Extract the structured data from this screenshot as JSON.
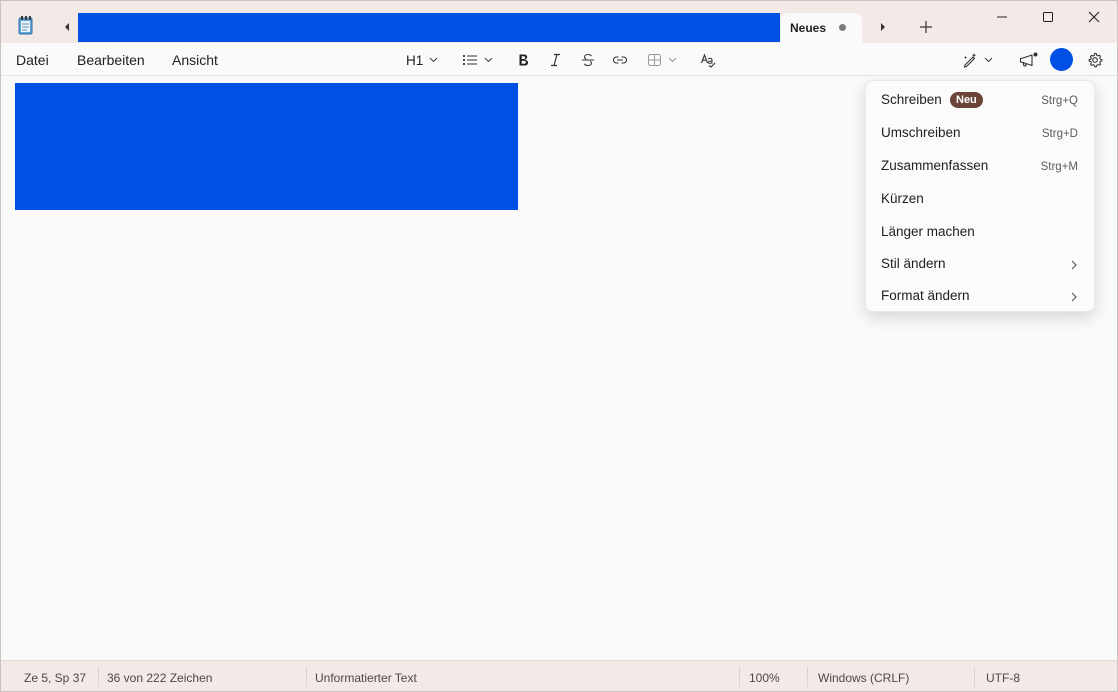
{
  "titlebar": {
    "active_tab": "Neues",
    "tab_modified": true
  },
  "menu": {
    "datei": "Datei",
    "bearbeiten": "Bearbeiten",
    "ansicht": "Ansicht"
  },
  "toolbar": {
    "heading_level": "H1",
    "icons": [
      "list-icon",
      "bold-icon",
      "italic-icon",
      "strikethrough-icon",
      "link-icon",
      "table-icon",
      "spellcheck-icon",
      "copilot-pen-icon",
      "megaphone-icon",
      "settings-icon"
    ]
  },
  "popup": {
    "items": [
      {
        "label": "Schreiben",
        "badge": "Neu",
        "shortcut": "Strg+Q"
      },
      {
        "label": "Umschreiben",
        "shortcut": "Strg+D"
      },
      {
        "label": "Zusammenfassen",
        "shortcut": "Strg+M"
      },
      {
        "label": "Kürzen"
      },
      {
        "label": "Länger machen"
      },
      {
        "label": "Stil ändern"
      },
      {
        "label": "Format ändern"
      }
    ]
  },
  "status": {
    "position": "Ze 5, Sp 37",
    "chars": "36 von 222 Zeichen",
    "format": "Unformatierter Text",
    "zoom": "100%",
    "line_endings": "Windows (CRLF)",
    "encoding": "UTF-8"
  },
  "colors": {
    "accent": "#0050e6",
    "titlebar_bg": "#f3e9e6",
    "badge_bg": "#6b4437"
  }
}
